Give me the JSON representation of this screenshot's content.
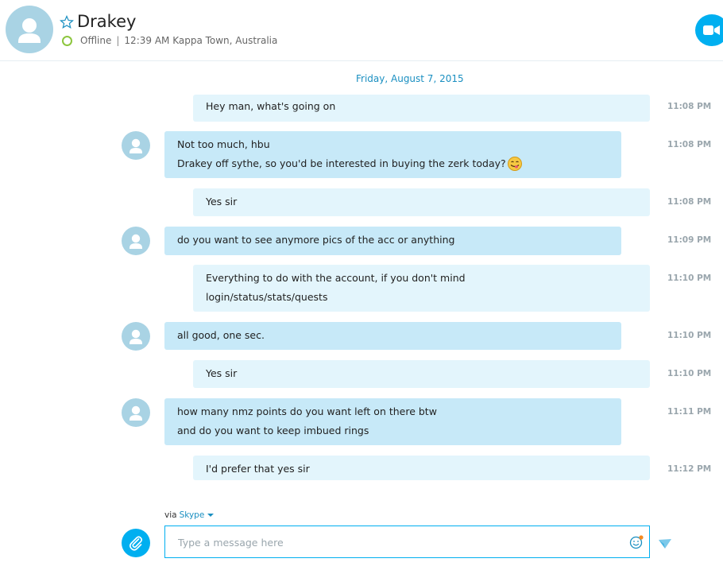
{
  "header": {
    "contact_name": "Drakey",
    "status": "Offline",
    "separator": "|",
    "local_time_location": "12:39 AM Kappa Town, Australia"
  },
  "conversation": {
    "date": "Friday, August 7, 2015",
    "messages": [
      {
        "side": "out",
        "lines": [
          "Hey man, what's going on"
        ],
        "time": "11:08 PM"
      },
      {
        "side": "in",
        "lines": [
          "Not too much, hbu",
          "Drakey off sythe, so you'd be interested in buying the zerk today?"
        ],
        "emoji": "smiling-tongue-face",
        "time": "11:08 PM"
      },
      {
        "side": "out",
        "lines": [
          "Yes sir"
        ],
        "time": "11:08 PM"
      },
      {
        "side": "in",
        "lines": [
          "do you want to see anymore pics of the acc or anything"
        ],
        "time": "11:09 PM"
      },
      {
        "side": "out",
        "lines": [
          "Everything to do with the account, if you don't mind",
          "login/status/stats/quests"
        ],
        "time": "11:10 PM"
      },
      {
        "side": "in",
        "lines": [
          "all good, one sec."
        ],
        "time": "11:10 PM"
      },
      {
        "side": "out",
        "lines": [
          "Yes sir"
        ],
        "time": "11:10 PM"
      },
      {
        "side": "in",
        "lines": [
          "how many nmz points do you want left on there btw",
          "and do you want to keep imbued rings"
        ],
        "time": "11:11 PM"
      },
      {
        "side": "out",
        "lines": [
          "I'd prefer that yes sir"
        ],
        "time": "11:12 PM"
      }
    ]
  },
  "composer": {
    "via_label": "via",
    "via_service": "Skype",
    "placeholder": "Type a message here",
    "value": ""
  },
  "icons": {
    "favorite": "star-outline-icon",
    "video_call": "video-camera-icon",
    "attach": "paperclip-icon",
    "emoticons": "smiley-icon",
    "send": "send-arrow-icon",
    "avatar": "person-silhouette-icon"
  },
  "colors": {
    "accent": "#00aff0",
    "incoming_bubble": "#c7e9f8",
    "outgoing_bubble": "#e3f5fc",
    "status_offline_ring": "#8dc63f",
    "date_text": "#1a8fc1"
  }
}
